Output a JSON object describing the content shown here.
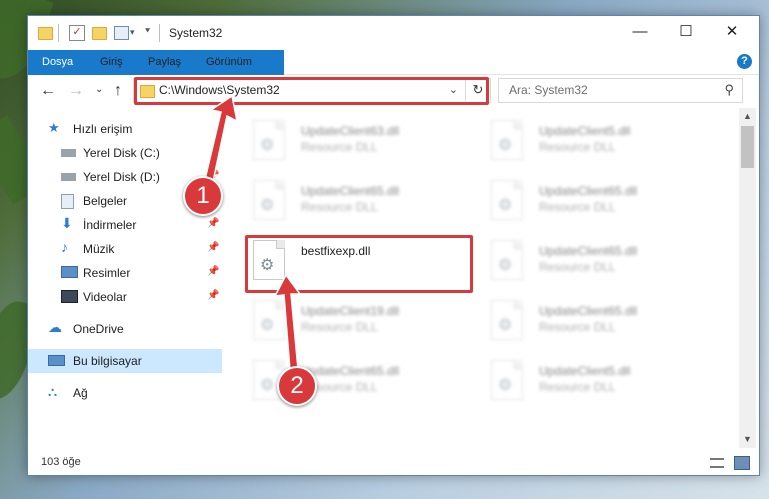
{
  "window": {
    "title": "System32"
  },
  "ribbon": {
    "tabs": [
      "Dosya",
      "Giriş",
      "Paylaş",
      "Görünüm"
    ],
    "help": "?"
  },
  "address": {
    "path": "C:\\Windows\\System32"
  },
  "search": {
    "placeholder": "Ara: System32"
  },
  "sidebar": {
    "items": [
      {
        "label": "Hızlı erişim",
        "icon": "star-icon"
      },
      {
        "label": "Yerel Disk (C:)",
        "icon": "drive-icon"
      },
      {
        "label": "Yerel Disk (D:)",
        "icon": "drive-icon"
      },
      {
        "label": "Belgeler",
        "icon": "documents-icon"
      },
      {
        "label": "İndirmeler",
        "icon": "download-icon"
      },
      {
        "label": "Müzik",
        "icon": "music-icon"
      },
      {
        "label": "Resimler",
        "icon": "pictures-icon"
      },
      {
        "label": "Videolar",
        "icon": "video-icon"
      },
      {
        "label": "OneDrive",
        "icon": "cloud-icon"
      },
      {
        "label": "Bu bilgisayar",
        "icon": "computer-icon"
      },
      {
        "label": "Ağ",
        "icon": "network-icon"
      }
    ]
  },
  "files": {
    "col1": [
      {
        "name": "UpdateClient63.dll",
        "type": "Resource DLL"
      },
      {
        "name": "UpdateClient65.dll",
        "type": "Resource DLL"
      },
      {
        "name": "bestfixexp.dll",
        "type": ""
      },
      {
        "name": "UpdateClient19.dll",
        "type": "Resource DLL"
      },
      {
        "name": "UpdateClient65.dll",
        "type": "Resource DLL"
      }
    ],
    "col2": [
      {
        "name": "UpdateClient5.dll",
        "type": "Resource DLL"
      },
      {
        "name": "UpdateClient65.dll",
        "type": "Resource DLL"
      },
      {
        "name": "UpdateClient65.dll",
        "type": "Resource DLL"
      },
      {
        "name": "UpdateClient65.dll",
        "type": "Resource DLL"
      },
      {
        "name": "UpdateClient5.dll",
        "type": "Resource DLL"
      }
    ]
  },
  "status": {
    "count": "103 öğe"
  },
  "annotations": {
    "step1": "1",
    "step2": "2"
  },
  "colors": {
    "accent": "#1979ca",
    "highlight": "#d9393a",
    "selected": "#cce8ff"
  }
}
